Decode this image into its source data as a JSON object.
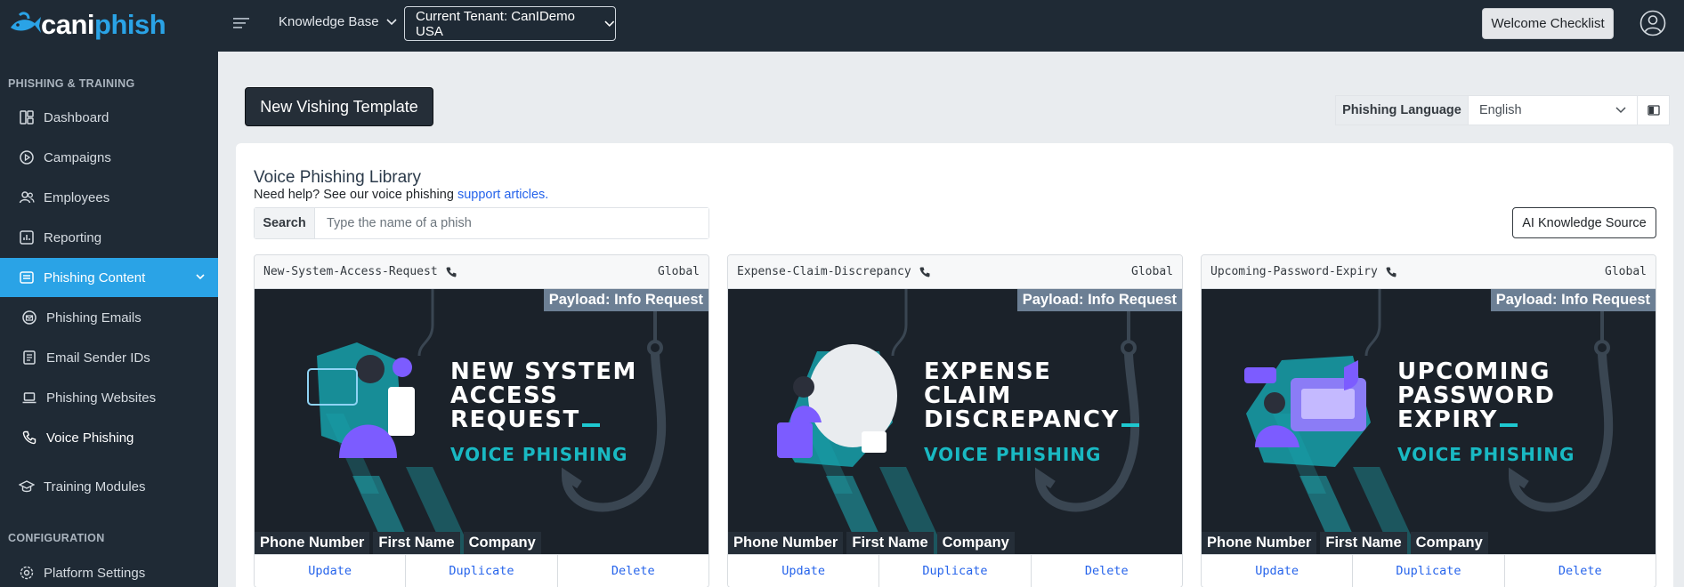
{
  "brand": {
    "name_part1": "cani",
    "name_part2": "phish"
  },
  "topbar": {
    "knowledge_base": "Knowledge Base",
    "tenant": "Current Tenant: CanIDemo USA",
    "welcome_checklist": "Welcome Checklist"
  },
  "sidebar": {
    "section1": "PHISHING & TRAINING",
    "section2": "CONFIGURATION",
    "items": [
      {
        "label": "Dashboard",
        "icon": "dashboard-icon"
      },
      {
        "label": "Campaigns",
        "icon": "play-circle-icon"
      },
      {
        "label": "Employees",
        "icon": "users-icon"
      },
      {
        "label": "Reporting",
        "icon": "chart-icon"
      },
      {
        "label": "Phishing Content",
        "icon": "layers-icon",
        "active": true
      },
      {
        "label": "Phishing Emails",
        "icon": "email-icon"
      },
      {
        "label": "Email Sender IDs",
        "icon": "id-icon"
      },
      {
        "label": "Phishing Websites",
        "icon": "laptop-icon"
      },
      {
        "label": "Voice Phishing",
        "icon": "phone-icon",
        "current": true
      },
      {
        "label": "Training Modules",
        "icon": "graduation-icon"
      },
      {
        "label": "Platform Settings",
        "icon": "gear-icon"
      }
    ]
  },
  "main": {
    "new_template_button": "New Vishing Template",
    "language": {
      "label": "Phishing Language",
      "value": "English"
    },
    "library_title": "Voice Phishing Library",
    "help_text": "Need help? See our voice phishing ",
    "help_link": "support articles.",
    "search": {
      "label": "Search",
      "placeholder": "Type the name of a phish"
    },
    "ai_button": "AI Knowledge Source"
  },
  "cards": [
    {
      "name": "New-System-Access-Request",
      "scope": "Global",
      "payload": "Payload: Info Request",
      "headline": [
        "NEW SYSTEM",
        "ACCESS",
        "REQUEST"
      ],
      "subtitle": "VOICE PHISHING",
      "tags": [
        "Phone Number",
        "First Name",
        "Company"
      ],
      "actions": [
        "Update",
        "Duplicate",
        "Delete"
      ]
    },
    {
      "name": "Expense-Claim-Discrepancy",
      "scope": "Global",
      "payload": "Payload: Info Request",
      "headline": [
        "EXPENSE",
        "CLAIM",
        "DISCREPANCY"
      ],
      "subtitle": "VOICE PHISHING",
      "tags": [
        "Phone Number",
        "First Name",
        "Company"
      ],
      "actions": [
        "Update",
        "Duplicate",
        "Delete"
      ]
    },
    {
      "name": "Upcoming-Password-Expiry",
      "scope": "Global",
      "payload": "Payload: Info Request",
      "headline": [
        "UPCOMING",
        "PASSWORD",
        "EXPIRY"
      ],
      "subtitle": "VOICE PHISHING",
      "tags": [
        "Phone Number",
        "First Name",
        "Company"
      ],
      "actions": [
        "Update",
        "Duplicate",
        "Delete"
      ]
    }
  ],
  "colors": {
    "topbar": "#1f2a35",
    "accent": "#2aa3e6",
    "link": "#2563eb",
    "teal": "#19b9c3"
  }
}
